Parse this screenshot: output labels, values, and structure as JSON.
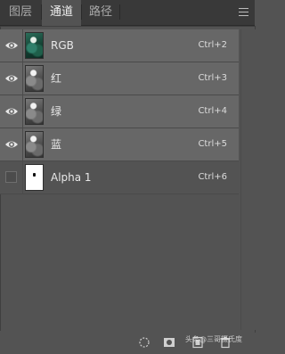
{
  "tabs": [
    {
      "label": "图层"
    },
    {
      "label": "通道"
    },
    {
      "label": "路径"
    }
  ],
  "channels": [
    {
      "name": "RGB",
      "shortcut": "Ctrl+2"
    },
    {
      "name": "红",
      "shortcut": "Ctrl+3"
    },
    {
      "name": "绿",
      "shortcut": "Ctrl+4"
    },
    {
      "name": "蓝",
      "shortcut": "Ctrl+5"
    },
    {
      "name": "Alpha 1",
      "shortcut": "Ctrl+6"
    }
  ],
  "footer": {
    "icons": [
      "load-selection-icon",
      "save-selection-icon",
      "new-channel-icon",
      "delete-channel-icon"
    ]
  },
  "watermark": "头条@三哥摄氏度",
  "colors": {
    "panel": "#535353",
    "tabbar": "#393939",
    "selected_row": "#676767"
  }
}
